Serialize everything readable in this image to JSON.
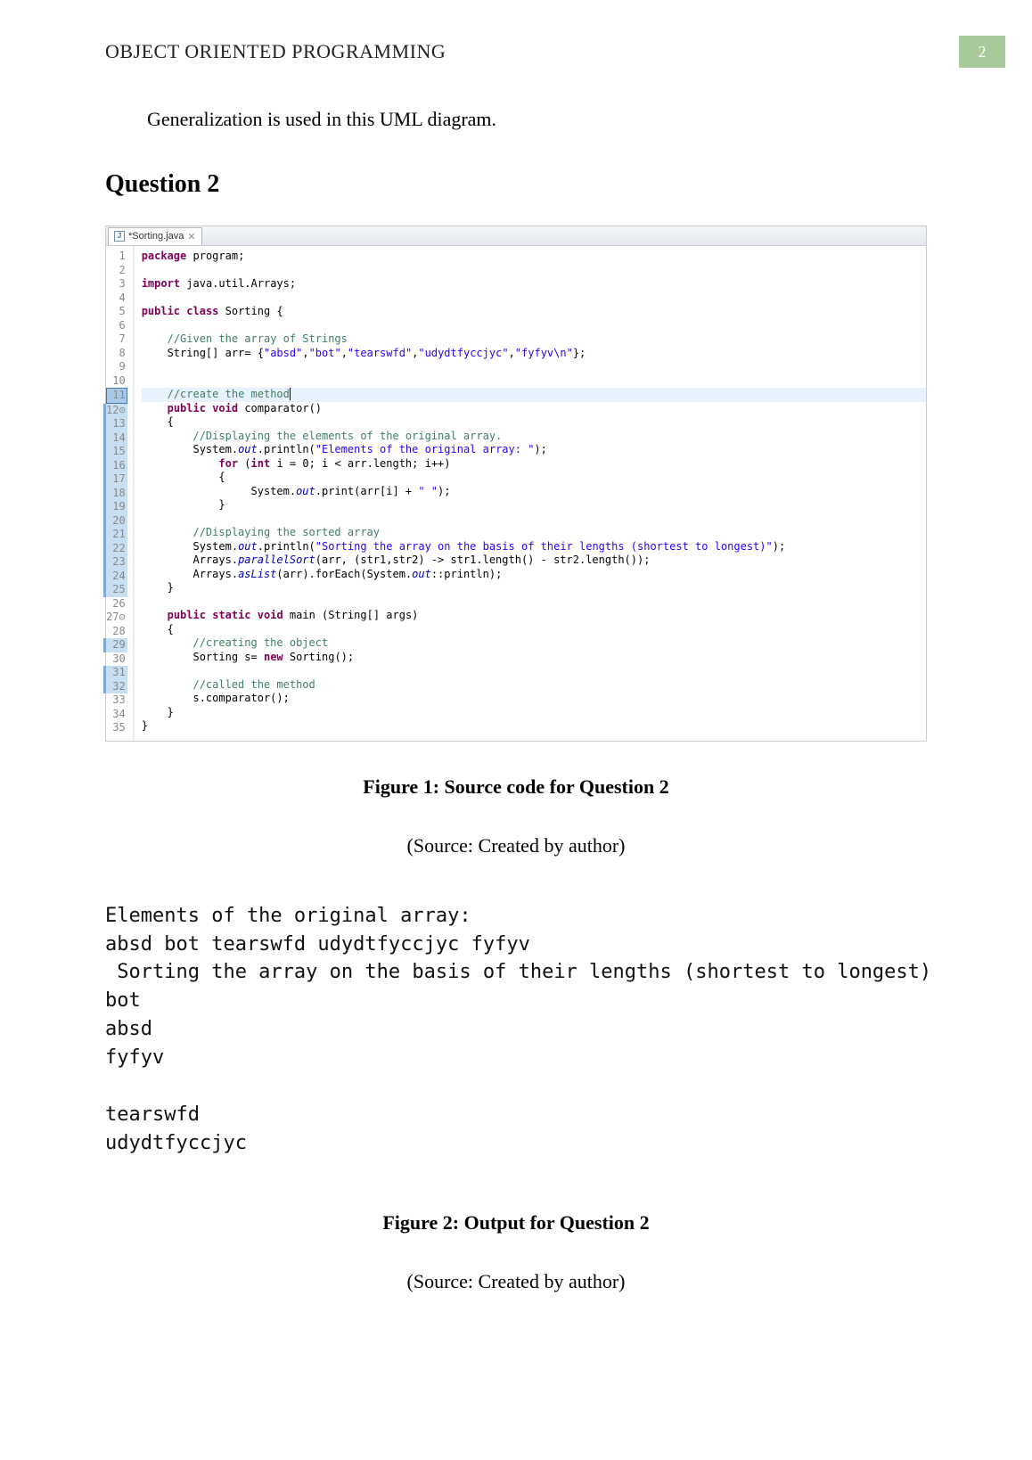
{
  "header": {
    "title": "OBJECT ORIENTED PROGRAMMING",
    "page_number": "2"
  },
  "body_text": "Generalization is used in this UML diagram.",
  "question_heading": "Question 2",
  "ide": {
    "tab_label": "*Sorting.java",
    "file_icon_letter": "J",
    "close_glyph": "✕",
    "gutter": [
      {
        "n": "1",
        "cls": ""
      },
      {
        "n": "2",
        "cls": ""
      },
      {
        "n": "3",
        "cls": ""
      },
      {
        "n": "4",
        "cls": ""
      },
      {
        "n": "5",
        "cls": ""
      },
      {
        "n": "6",
        "cls": ""
      },
      {
        "n": "7",
        "cls": ""
      },
      {
        "n": "8",
        "cls": ""
      },
      {
        "n": "9",
        "cls": ""
      },
      {
        "n": "10",
        "cls": ""
      },
      {
        "n": "11",
        "cls": "box-marker"
      },
      {
        "n": "12⊝",
        "cls": "marked"
      },
      {
        "n": "13",
        "cls": "marked"
      },
      {
        "n": "14",
        "cls": "marked"
      },
      {
        "n": "15",
        "cls": "marked"
      },
      {
        "n": "16",
        "cls": "marked"
      },
      {
        "n": "17",
        "cls": "marked"
      },
      {
        "n": "18",
        "cls": "marked"
      },
      {
        "n": "19",
        "cls": "marked"
      },
      {
        "n": "20",
        "cls": "marked"
      },
      {
        "n": "21",
        "cls": "marked"
      },
      {
        "n": "22",
        "cls": "marked"
      },
      {
        "n": "23",
        "cls": "marked"
      },
      {
        "n": "24",
        "cls": "marked"
      },
      {
        "n": "25",
        "cls": "marked"
      },
      {
        "n": "26",
        "cls": ""
      },
      {
        "n": "27⊝",
        "cls": ""
      },
      {
        "n": "28",
        "cls": ""
      },
      {
        "n": "29",
        "cls": "marked"
      },
      {
        "n": "30",
        "cls": ""
      },
      {
        "n": "31",
        "cls": "marked"
      },
      {
        "n": "32",
        "cls": "marked"
      },
      {
        "n": "33",
        "cls": ""
      },
      {
        "n": "34",
        "cls": ""
      },
      {
        "n": "35",
        "cls": ""
      }
    ],
    "code": [
      {
        "hl": false,
        "html": "<span class='kw'>package</span> program;"
      },
      {
        "hl": false,
        "html": ""
      },
      {
        "hl": false,
        "html": "<span class='kw'>import</span> java.util.Arrays;"
      },
      {
        "hl": false,
        "html": ""
      },
      {
        "hl": false,
        "html": "<span class='kw'>public</span> <span class='kw'>class</span> Sorting {"
      },
      {
        "hl": false,
        "html": ""
      },
      {
        "hl": false,
        "html": "    <span class='cm'>//Given the array of Strings</span>"
      },
      {
        "hl": false,
        "html": "    String[] arr= {<span class='st'>\"absd\"</span>,<span class='st'>\"bot\"</span>,<span class='st'>\"tearswfd\"</span>,<span class='st'>\"udydtfyccjyc\"</span>,<span class='st'>\"fyfyv\\n\"</span>};"
      },
      {
        "hl": false,
        "html": ""
      },
      {
        "hl": false,
        "html": ""
      },
      {
        "hl": true,
        "html": "    <span class='cm'>//create the method</span><span class='cursor'></span>"
      },
      {
        "hl": false,
        "html": "    <span class='kw'>public</span> <span class='kw'>void</span> comparator()"
      },
      {
        "hl": false,
        "html": "    {"
      },
      {
        "hl": false,
        "html": "        <span class='cm'>//Displaying the elements of the original array.</span>"
      },
      {
        "hl": false,
        "html": "        System.<span class='fld'>out</span>.println(<span class='st'>\"Elements of the original array: \"</span>);"
      },
      {
        "hl": false,
        "html": "            <span class='kw'>for</span> (<span class='kw'>int</span> i = 0; i &lt; arr.length; i++)"
      },
      {
        "hl": false,
        "html": "            {"
      },
      {
        "hl": false,
        "html": "                 System.<span class='fld'>out</span>.print(arr[i] + <span class='st'>\" \"</span>);"
      },
      {
        "hl": false,
        "html": "            }"
      },
      {
        "hl": false,
        "html": ""
      },
      {
        "hl": false,
        "html": "        <span class='cm'>//Displaying the sorted array</span>"
      },
      {
        "hl": false,
        "html": "        System.<span class='fld'>out</span>.println(<span class='st'>\"Sorting the array on the basis of their lengths (shortest to longest)\"</span>);"
      },
      {
        "hl": false,
        "html": "        Arrays.<span class='fld'>parallelSort</span>(arr, (str1,str2) -&gt; str1.length() - str2.length());"
      },
      {
        "hl": false,
        "html": "        Arrays.<span class='fld'>asList</span>(arr).forEach(System.<span class='fld'>out</span>::println);"
      },
      {
        "hl": false,
        "html": "    }"
      },
      {
        "hl": false,
        "html": ""
      },
      {
        "hl": false,
        "html": "    <span class='kw'>public</span> <span class='kw'>static</span> <span class='kw'>void</span> main (String[] args)"
      },
      {
        "hl": false,
        "html": "    {"
      },
      {
        "hl": false,
        "html": "        <span class='cm'>//creating the object</span>"
      },
      {
        "hl": false,
        "html": "        Sorting s= <span class='kw'>new</span> Sorting();"
      },
      {
        "hl": false,
        "html": ""
      },
      {
        "hl": false,
        "html": "        <span class='cm'>//called the method</span>"
      },
      {
        "hl": false,
        "html": "        s.comparator();"
      },
      {
        "hl": false,
        "html": "    }"
      },
      {
        "hl": false,
        "html": "}"
      }
    ]
  },
  "figure1_caption": "Figure 1: Source code for Question 2",
  "figure1_source": "(Source: Created by author)",
  "console_output": "Elements of the original array:\nabsd bot tearswfd udydtfyccjyc fyfyv\n Sorting the array on the basis of their lengths (shortest to longest)\nbot\nabsd\nfyfyv\n\ntearswfd\nudydtfyccjyc",
  "figure2_caption": "Figure 2: Output for Question 2",
  "figure2_source": "(Source: Created by author)"
}
